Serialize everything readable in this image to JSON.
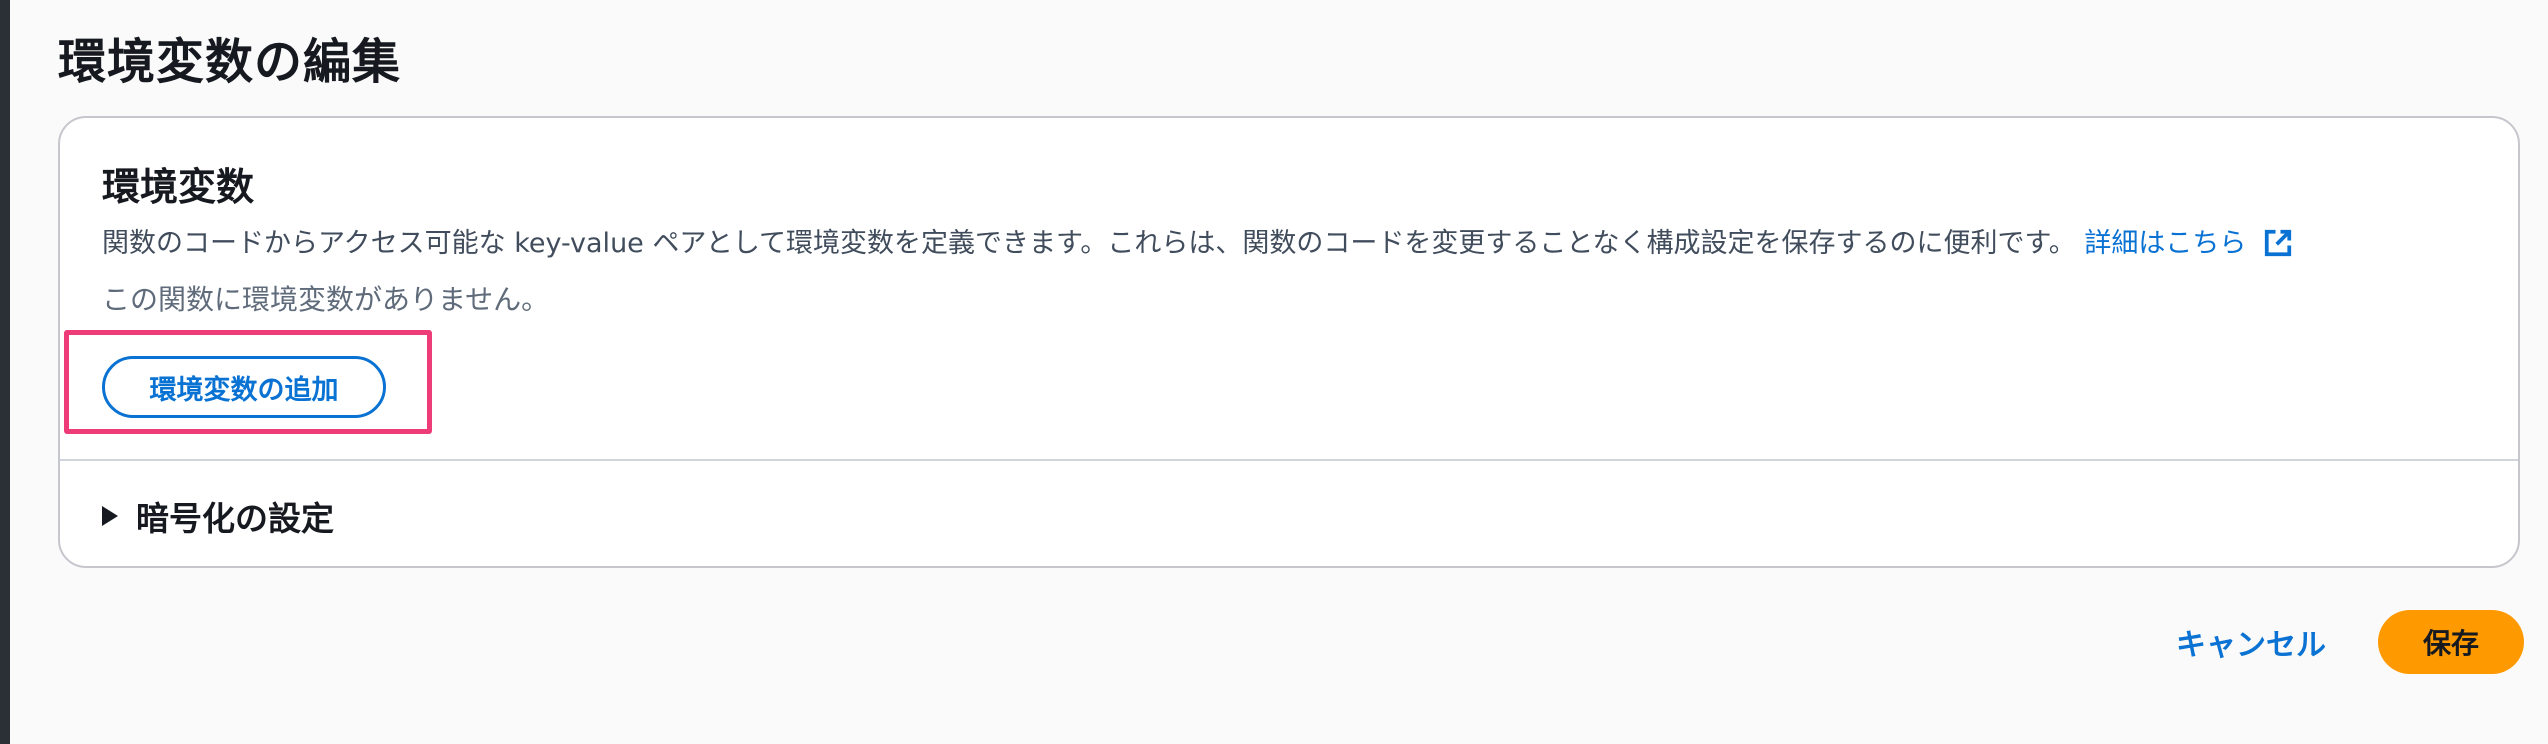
{
  "page": {
    "title": "環境変数の編集"
  },
  "panel": {
    "title": "環境変数",
    "description": "関数のコードからアクセス可能な key-value ペアとして環境変数を定義できます。これらは、関数のコードを変更することなく構成設定を保存するのに便利です。",
    "learn_more_label": "詳細はこちら",
    "external_icon": "external-link-icon",
    "empty_message": "この関数に環境変数がありません。",
    "add_button_label": "環境変数の追加",
    "encryption_section_label": "暗号化の設定",
    "encryption_expanded": false
  },
  "footer": {
    "cancel_label": "キャンセル",
    "save_label": "保存"
  },
  "colors": {
    "link": "#0972d3",
    "primary_button": "#ff9900",
    "highlight": "#ee3c79"
  }
}
